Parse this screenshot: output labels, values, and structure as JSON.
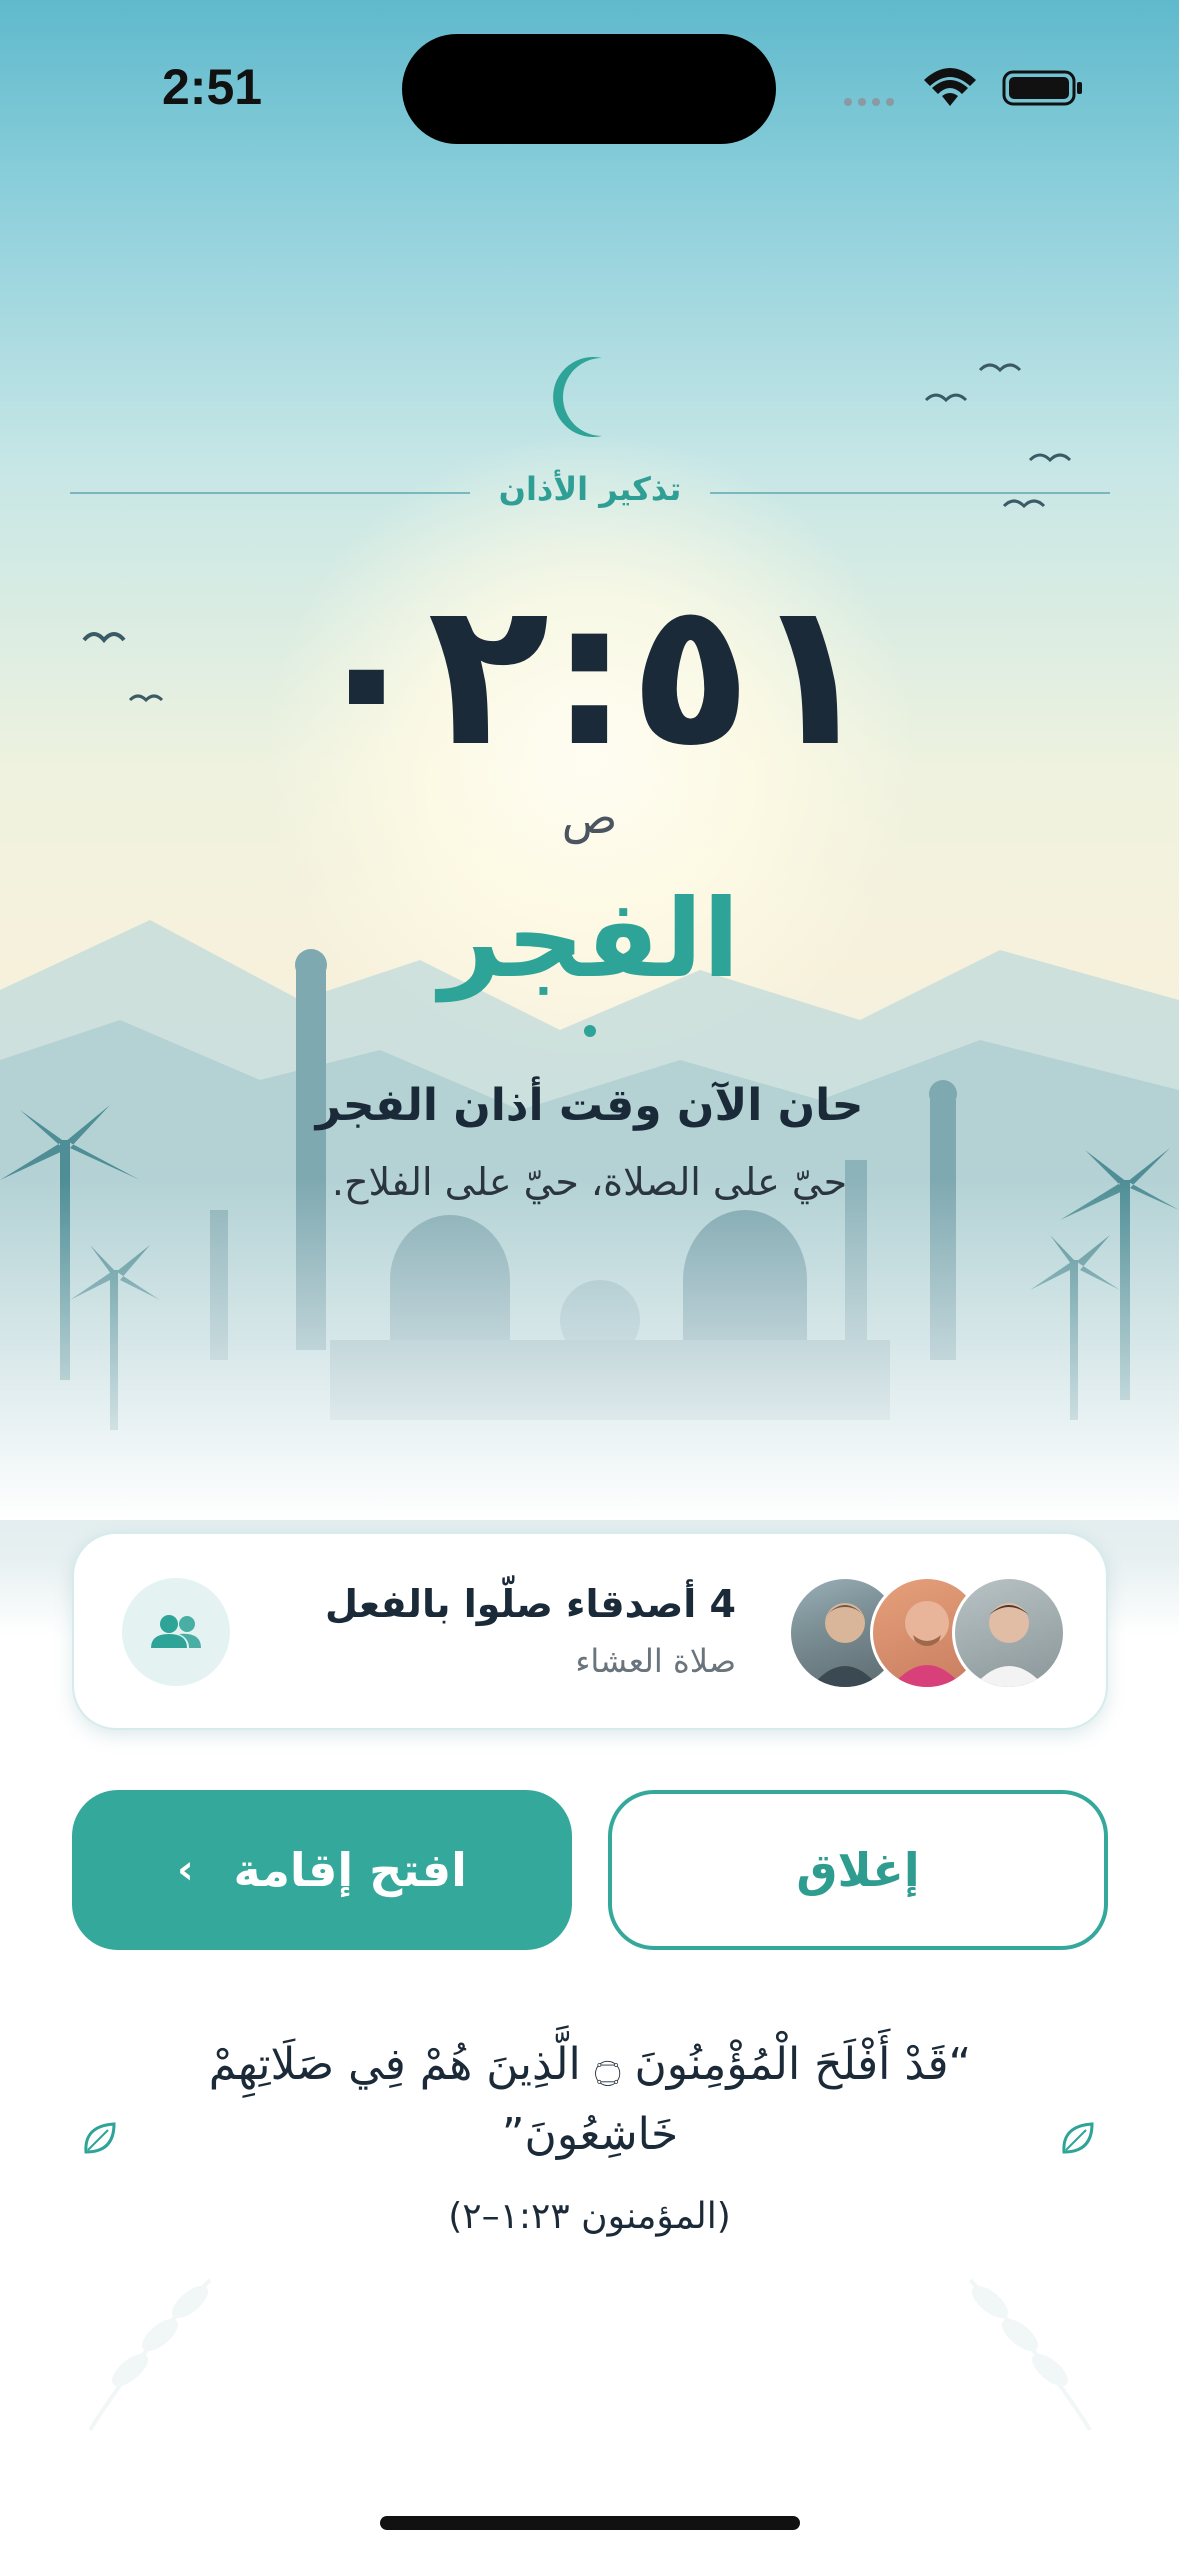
{
  "status_bar": {
    "time": "2:51"
  },
  "reminder": {
    "label": "تذكير الأذان",
    "time": "٠٢:٥١",
    "period": "ص",
    "prayer_name": "الفجر",
    "headline": "حان الآن وقت أذان الفجر",
    "subtext": "حيّ على الصلاة، حيّ على الفلاح."
  },
  "friends": {
    "title": "4 أصدقاء صلّوا بالفعل",
    "subtitle": "صلاة العشاء",
    "icon": "people-icon"
  },
  "actions": {
    "open_iqama_label": "افتح إقامة",
    "close_label": "إغلاق"
  },
  "verse": {
    "text": "“قَدْ أَفْلَحَ الْمُؤْمِنُونَ ۝ الَّذِينَ هُمْ فِي صَلَاتِهِمْ خَاشِعُونَ”",
    "reference": "(المؤمنون ١:٢٣–٢)"
  },
  "colors": {
    "accent": "#34a89b",
    "text_dark": "#1b2a38"
  }
}
